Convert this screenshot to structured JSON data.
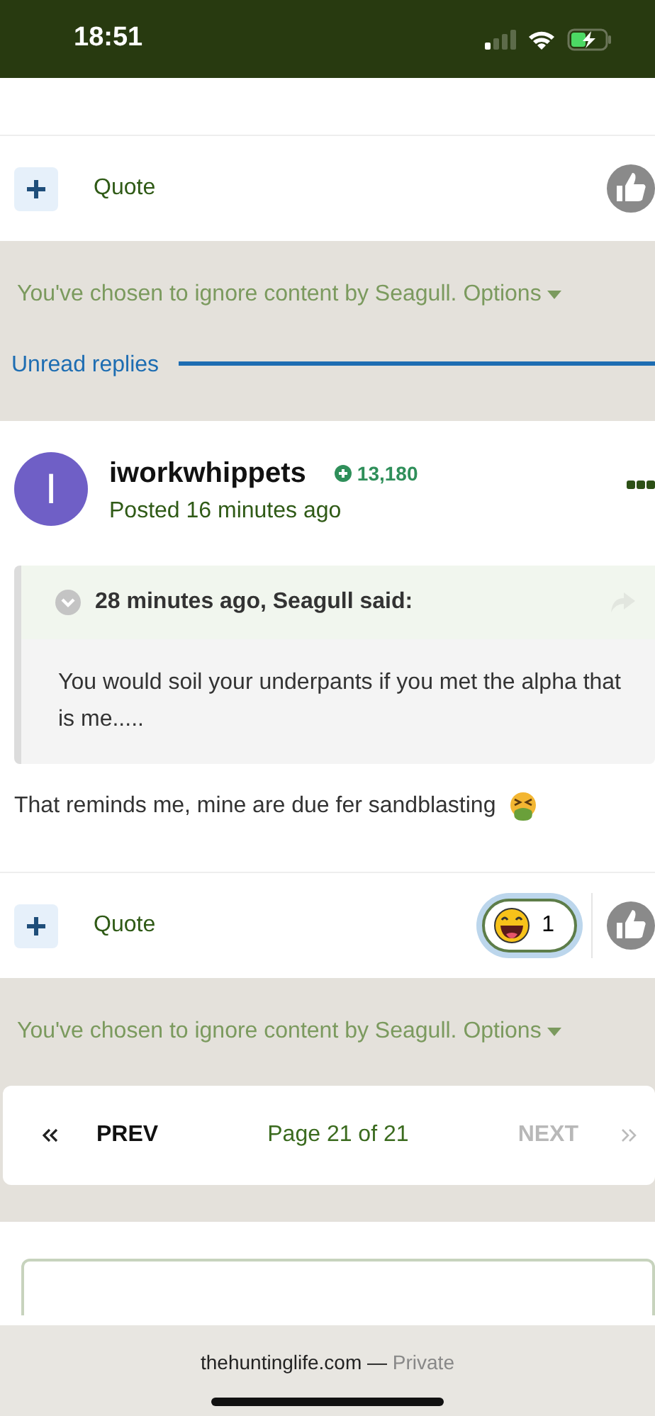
{
  "status_bar": {
    "time": "18:51"
  },
  "feed": [
    {
      "kind": "actions",
      "quote": "Quote"
    },
    {
      "kind": "ignored",
      "text": "You've chosen to ignore content by Seagull.",
      "options": "Options"
    },
    {
      "kind": "unread",
      "label": "Unread replies"
    },
    {
      "kind": "post",
      "avatar_letter": "I",
      "author": "iworkwhippets",
      "reputation": "13,180",
      "posted": "Posted 16 minutes ago",
      "quote_header": "28 minutes ago, Seagull said:",
      "quote_text": "You would soil your underpants if you met the alpha that is me.....",
      "body": "That reminds me, mine are due fer sandblasting"
    },
    {
      "kind": "actions",
      "quote": "Quote",
      "reaction_count": "1",
      "reaction_selected": true
    },
    {
      "kind": "ignored",
      "text": "You've chosen to ignore content by Seagull.",
      "options": "Options"
    },
    {
      "kind": "pagination",
      "prev": "PREV",
      "page": "Page 21 of 21",
      "next": "NEXT",
      "next_disabled": true
    },
    {
      "kind": "reply_box"
    }
  ],
  "browser_bar": {
    "domain": "thehuntinglife.com",
    "separator": "—",
    "mode": "Private"
  }
}
